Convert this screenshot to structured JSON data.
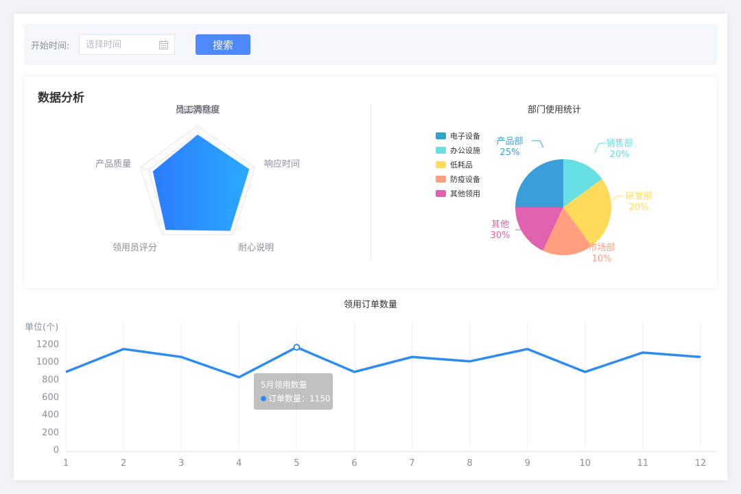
{
  "filter": {
    "start_label": "开始时间:",
    "start_placeholder": "选择时间",
    "search_label": "搜索"
  },
  "section_title": "数据分析",
  "colors": {
    "accent": "#4d88ff",
    "line": "#2e8cf0"
  },
  "chart_data": [
    {
      "type": "radar",
      "title": "员工满意度",
      "indicators": [
        "服务评价",
        "响应时间",
        "耐心说明",
        "领用员评分",
        "产品质量"
      ],
      "max": 100,
      "values": [
        85,
        90,
        92,
        90,
        78
      ]
    },
    {
      "type": "pie",
      "title": "部门使用统计",
      "legend": [
        "电子设备",
        "办公设施",
        "低耗品",
        "防疫设备",
        "其他领用"
      ],
      "legend_position": "left",
      "slices": [
        {
          "label": "产品部",
          "percent_label": "25%",
          "value": 25,
          "color": "#3a9fd8"
        },
        {
          "label": "销售部",
          "percent_label": "20%",
          "value": 15,
          "color": "#66e0e3"
        },
        {
          "label": "研发部",
          "percent_label": "20%",
          "value": 25,
          "color": "#ffdb5c"
        },
        {
          "label": "市场部",
          "percent_label": "10%",
          "value": 17,
          "color": "#ff9f7f"
        },
        {
          "label": "其他",
          "percent_label": "30%",
          "value": 18,
          "color": "#e062ae"
        }
      ],
      "legend_colors": [
        "#2ba6c9",
        "#66e0e3",
        "#ffdb5c",
        "#ff9f7f",
        "#e062ae"
      ]
    },
    {
      "type": "line",
      "title": "领用订单数量",
      "ylabel": "单位(个)",
      "x": [
        "1",
        "2",
        "3",
        "4",
        "5",
        "6",
        "7",
        "8",
        "9",
        "10",
        "11",
        "12"
      ],
      "series": [
        {
          "name": "订单数量",
          "values": [
            880,
            1140,
            1050,
            820,
            1160,
            880,
            1050,
            1000,
            1140,
            880,
            1100,
            1050
          ]
        }
      ],
      "ylim": [
        0,
        1200
      ],
      "yticks": [
        0,
        200,
        400,
        600,
        800,
        1000,
        1200
      ],
      "grid_x": true,
      "tooltip": {
        "title": "5月领用数量",
        "label": "订单数量：",
        "value": "1150",
        "index": 4
      }
    }
  ]
}
